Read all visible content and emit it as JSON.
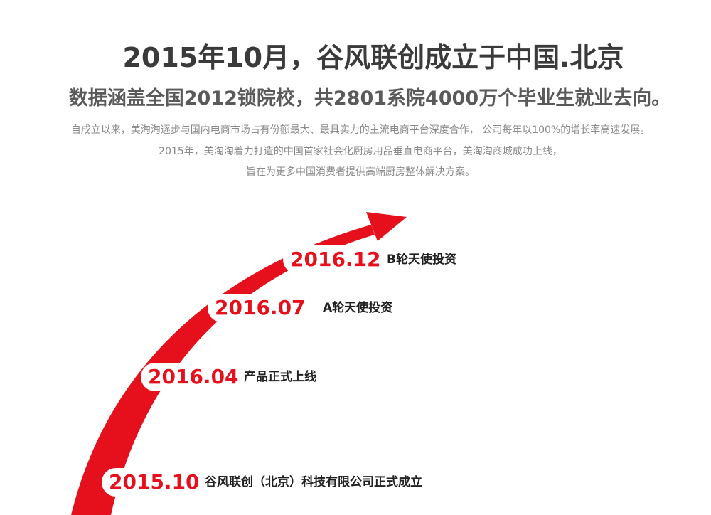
{
  "header": {
    "headline": "2015年10月，谷风联创成立于中国.北京",
    "subhead": "数据涵盖全国2012锁院校，共2801系院4000万个毕业生就业去向。"
  },
  "intro": {
    "line1": "自成立以来，美淘淘逐步与国内电商市场占有份额最大、最具实力的主流电商平台深度合作， 公司每年以100%的增长率高速发展。",
    "line2": "2015年，美淘淘着力打造的中国首家社会化厨房用品垂直电商平台，美淘淘商城成功上线，",
    "line3": "旨在为更多中国消费者提供高端厨房整体解决方案。"
  },
  "timeline": {
    "accent_color": "#e6101c",
    "milestones": [
      {
        "date": "2015.10",
        "event": "谷风联创（北京）科技有限公司正式成立"
      },
      {
        "date": "2016.04",
        "event": "产品正式上线"
      },
      {
        "date": "2016.07",
        "event": "A轮天使投资"
      },
      {
        "date": "2016.12",
        "event": "B轮天使投资"
      }
    ]
  }
}
